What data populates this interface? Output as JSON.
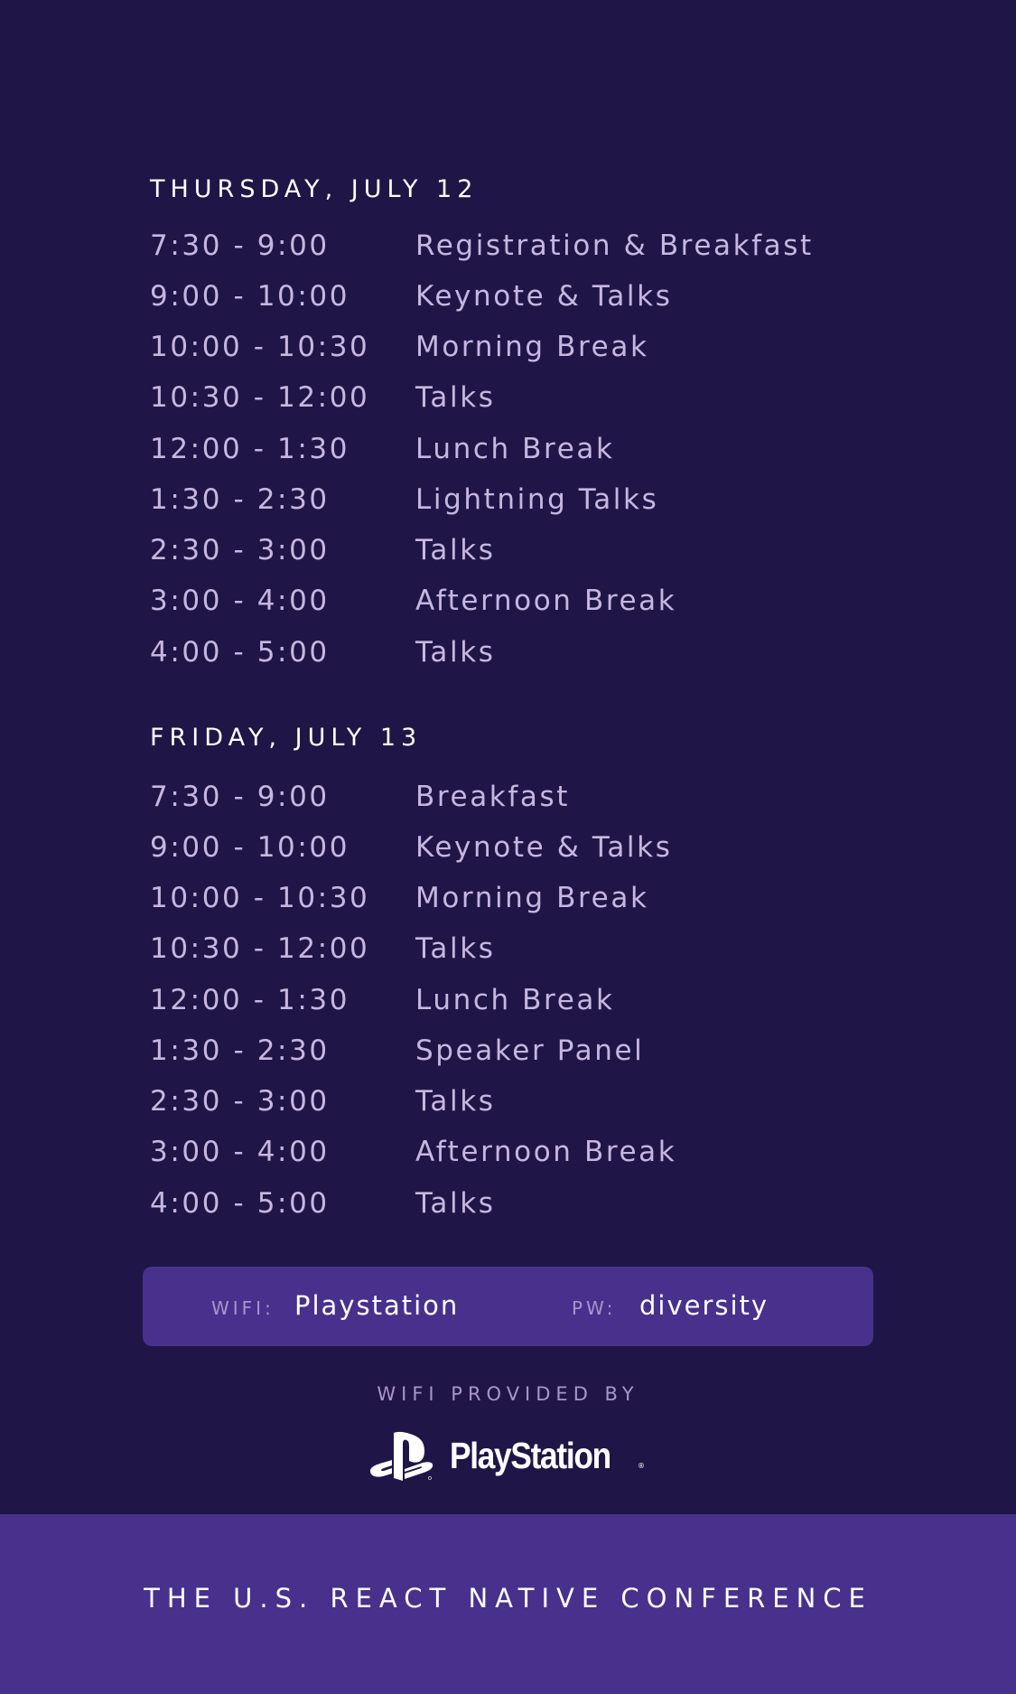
{
  "days": [
    {
      "heading": "THURSDAY, JULY 12",
      "items": [
        {
          "time": "7:30 - 9:00",
          "event": "Registration & Breakfast"
        },
        {
          "time": "9:00 - 10:00",
          "event": "Keynote & Talks"
        },
        {
          "time": "10:00 - 10:30",
          "event": "Morning Break"
        },
        {
          "time": "10:30 - 12:00",
          "event": "Talks"
        },
        {
          "time": "12:00 - 1:30",
          "event": "Lunch Break"
        },
        {
          "time": "1:30 - 2:30",
          "event": "Lightning Talks"
        },
        {
          "time": "2:30 - 3:00",
          "event": "Talks"
        },
        {
          "time": "3:00 - 4:00",
          "event": "Afternoon Break"
        },
        {
          "time": "4:00 - 5:00",
          "event": "Talks"
        }
      ]
    },
    {
      "heading": "FRIDAY, JULY 13",
      "items": [
        {
          "time": "7:30 - 9:00",
          "event": "Breakfast"
        },
        {
          "time": "9:00 - 10:00",
          "event": "Keynote & Talks"
        },
        {
          "time": "10:00 - 10:30",
          "event": "Morning Break"
        },
        {
          "time": "10:30 - 12:00",
          "event": "Talks"
        },
        {
          "time": "12:00 - 1:30",
          "event": "Lunch Break"
        },
        {
          "time": "1:30 - 2:30",
          "event": "Speaker Panel"
        },
        {
          "time": "2:30 - 3:00",
          "event": "Talks"
        },
        {
          "time": "3:00 - 4:00",
          "event": "Afternoon Break"
        },
        {
          "time": "4:00 - 5:00",
          "event": "Talks"
        }
      ]
    }
  ],
  "wifi": {
    "network_label": "WIFI:",
    "network": "Playstation",
    "password_label": "PW:",
    "password": "diversity"
  },
  "sponsor": {
    "provided_by": "WIFI PROVIDED BY",
    "logo_text": "PlayStation",
    "logo_icon": "playstation-logo-icon"
  },
  "footer": {
    "text": "THE U.S. REACT NATIVE CONFERENCE"
  },
  "colors": {
    "background": "#1f1647",
    "panel": "#47318d",
    "schedule_text": "#c6b7e0",
    "muted_label": "#a895cc",
    "heading": "#ffffff"
  }
}
